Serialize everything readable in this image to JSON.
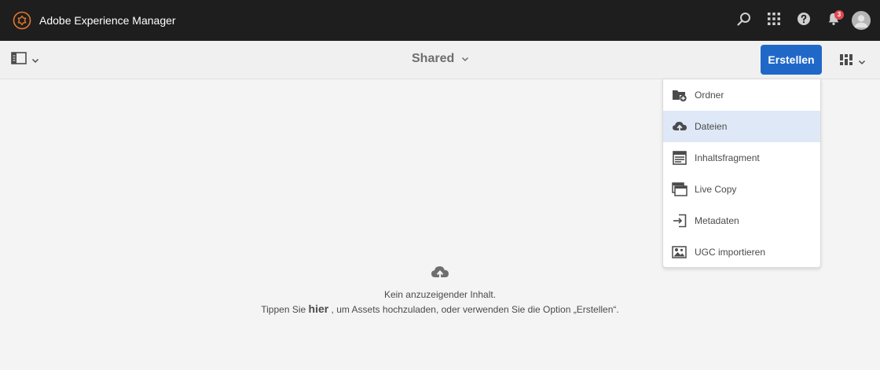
{
  "header": {
    "app_title": "Adobe Experience Manager",
    "notification_count": "3",
    "icons": [
      "experience-manager-logo-icon",
      "search-icon",
      "apps-grid-icon",
      "help-icon",
      "bell-icon",
      "user-avatar"
    ]
  },
  "actionbar": {
    "rail_toggle_icon": "rail-toggle-icon",
    "title": "Shared",
    "create_label": "Erstellen",
    "view_switch_icon": "card-view-icon"
  },
  "create_menu": {
    "items": [
      {
        "label": "Ordner",
        "icon": "new-folder-icon"
      },
      {
        "label": "Dateien",
        "icon": "upload-cloud-icon",
        "highlighted": true
      },
      {
        "label": "Inhaltsfragment",
        "icon": "content-fragment-icon"
      },
      {
        "label": "Live Copy",
        "icon": "live-copy-icon"
      },
      {
        "label": "Metadaten",
        "icon": "import-metadata-icon"
      },
      {
        "label": "UGC importieren",
        "icon": "import-ugc-icon"
      }
    ]
  },
  "empty_state": {
    "icon": "upload-cloud-icon",
    "line1": "Kein anzuzeigender Inhalt.",
    "line2_before": "Tippen Sie ",
    "line2_link": "hier",
    "line2_after": " , um Assets hochzuladen, oder verwenden Sie die Option „Erstellen“."
  },
  "colors": {
    "header_bg": "#1e1e1e",
    "accent_blue": "#2068c8",
    "highlight_row": "#dfe8f7",
    "badge_red": "#e34850"
  }
}
